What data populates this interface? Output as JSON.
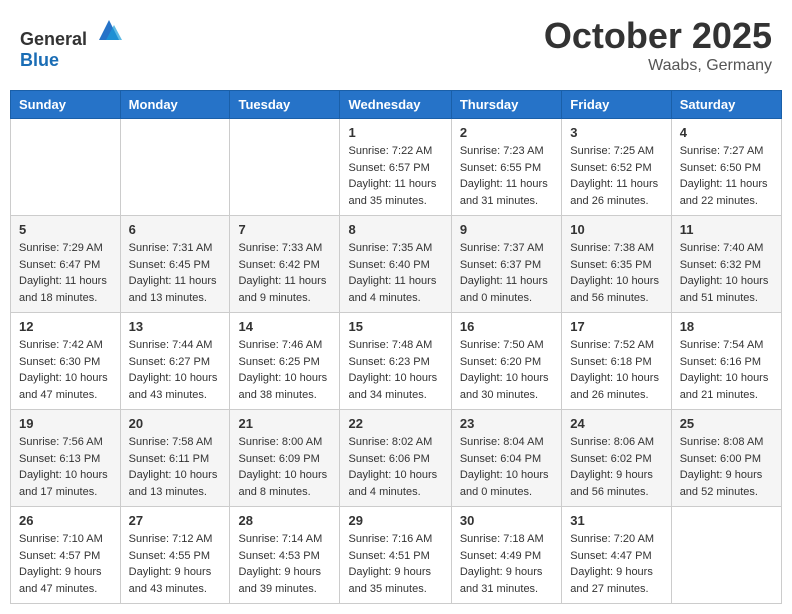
{
  "header": {
    "logo_general": "General",
    "logo_blue": "Blue",
    "month": "October 2025",
    "location": "Waabs, Germany"
  },
  "weekdays": [
    "Sunday",
    "Monday",
    "Tuesday",
    "Wednesday",
    "Thursday",
    "Friday",
    "Saturday"
  ],
  "weeks": [
    [
      {
        "day": "",
        "info": ""
      },
      {
        "day": "",
        "info": ""
      },
      {
        "day": "",
        "info": ""
      },
      {
        "day": "1",
        "info": "Sunrise: 7:22 AM\nSunset: 6:57 PM\nDaylight: 11 hours and 35 minutes."
      },
      {
        "day": "2",
        "info": "Sunrise: 7:23 AM\nSunset: 6:55 PM\nDaylight: 11 hours and 31 minutes."
      },
      {
        "day": "3",
        "info": "Sunrise: 7:25 AM\nSunset: 6:52 PM\nDaylight: 11 hours and 26 minutes."
      },
      {
        "day": "4",
        "info": "Sunrise: 7:27 AM\nSunset: 6:50 PM\nDaylight: 11 hours and 22 minutes."
      }
    ],
    [
      {
        "day": "5",
        "info": "Sunrise: 7:29 AM\nSunset: 6:47 PM\nDaylight: 11 hours and 18 minutes."
      },
      {
        "day": "6",
        "info": "Sunrise: 7:31 AM\nSunset: 6:45 PM\nDaylight: 11 hours and 13 minutes."
      },
      {
        "day": "7",
        "info": "Sunrise: 7:33 AM\nSunset: 6:42 PM\nDaylight: 11 hours and 9 minutes."
      },
      {
        "day": "8",
        "info": "Sunrise: 7:35 AM\nSunset: 6:40 PM\nDaylight: 11 hours and 4 minutes."
      },
      {
        "day": "9",
        "info": "Sunrise: 7:37 AM\nSunset: 6:37 PM\nDaylight: 11 hours and 0 minutes."
      },
      {
        "day": "10",
        "info": "Sunrise: 7:38 AM\nSunset: 6:35 PM\nDaylight: 10 hours and 56 minutes."
      },
      {
        "day": "11",
        "info": "Sunrise: 7:40 AM\nSunset: 6:32 PM\nDaylight: 10 hours and 51 minutes."
      }
    ],
    [
      {
        "day": "12",
        "info": "Sunrise: 7:42 AM\nSunset: 6:30 PM\nDaylight: 10 hours and 47 minutes."
      },
      {
        "day": "13",
        "info": "Sunrise: 7:44 AM\nSunset: 6:27 PM\nDaylight: 10 hours and 43 minutes."
      },
      {
        "day": "14",
        "info": "Sunrise: 7:46 AM\nSunset: 6:25 PM\nDaylight: 10 hours and 38 minutes."
      },
      {
        "day": "15",
        "info": "Sunrise: 7:48 AM\nSunset: 6:23 PM\nDaylight: 10 hours and 34 minutes."
      },
      {
        "day": "16",
        "info": "Sunrise: 7:50 AM\nSunset: 6:20 PM\nDaylight: 10 hours and 30 minutes."
      },
      {
        "day": "17",
        "info": "Sunrise: 7:52 AM\nSunset: 6:18 PM\nDaylight: 10 hours and 26 minutes."
      },
      {
        "day": "18",
        "info": "Sunrise: 7:54 AM\nSunset: 6:16 PM\nDaylight: 10 hours and 21 minutes."
      }
    ],
    [
      {
        "day": "19",
        "info": "Sunrise: 7:56 AM\nSunset: 6:13 PM\nDaylight: 10 hours and 17 minutes."
      },
      {
        "day": "20",
        "info": "Sunrise: 7:58 AM\nSunset: 6:11 PM\nDaylight: 10 hours and 13 minutes."
      },
      {
        "day": "21",
        "info": "Sunrise: 8:00 AM\nSunset: 6:09 PM\nDaylight: 10 hours and 8 minutes."
      },
      {
        "day": "22",
        "info": "Sunrise: 8:02 AM\nSunset: 6:06 PM\nDaylight: 10 hours and 4 minutes."
      },
      {
        "day": "23",
        "info": "Sunrise: 8:04 AM\nSunset: 6:04 PM\nDaylight: 10 hours and 0 minutes."
      },
      {
        "day": "24",
        "info": "Sunrise: 8:06 AM\nSunset: 6:02 PM\nDaylight: 9 hours and 56 minutes."
      },
      {
        "day": "25",
        "info": "Sunrise: 8:08 AM\nSunset: 6:00 PM\nDaylight: 9 hours and 52 minutes."
      }
    ],
    [
      {
        "day": "26",
        "info": "Sunrise: 7:10 AM\nSunset: 4:57 PM\nDaylight: 9 hours and 47 minutes."
      },
      {
        "day": "27",
        "info": "Sunrise: 7:12 AM\nSunset: 4:55 PM\nDaylight: 9 hours and 43 minutes."
      },
      {
        "day": "28",
        "info": "Sunrise: 7:14 AM\nSunset: 4:53 PM\nDaylight: 9 hours and 39 minutes."
      },
      {
        "day": "29",
        "info": "Sunrise: 7:16 AM\nSunset: 4:51 PM\nDaylight: 9 hours and 35 minutes."
      },
      {
        "day": "30",
        "info": "Sunrise: 7:18 AM\nSunset: 4:49 PM\nDaylight: 9 hours and 31 minutes."
      },
      {
        "day": "31",
        "info": "Sunrise: 7:20 AM\nSunset: 4:47 PM\nDaylight: 9 hours and 27 minutes."
      },
      {
        "day": "",
        "info": ""
      }
    ]
  ]
}
